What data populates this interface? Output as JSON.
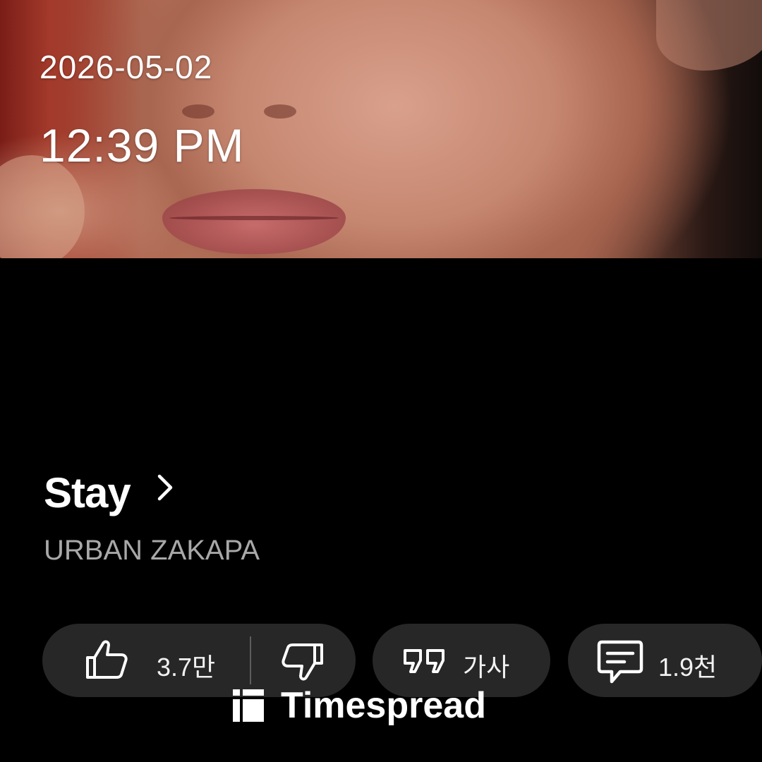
{
  "overlay": {
    "date": "2026-05-02",
    "time": "12:39 PM"
  },
  "track": {
    "title": "Stay",
    "artist": "URBAN ZAKAPA"
  },
  "actions": {
    "like_count": "3.7만",
    "lyrics_label": "가사",
    "comment_count": "1.9천"
  },
  "watermark": {
    "text": "Timespread"
  },
  "icons": [
    "chevron-right-icon",
    "thumbs-up-icon",
    "thumbs-down-icon",
    "lyrics-quote-icon",
    "comment-icon",
    "timespread-logo-icon"
  ],
  "colors": {
    "background": "#000000",
    "pill": "#272727",
    "secondary_text": "#a8a8a8"
  }
}
